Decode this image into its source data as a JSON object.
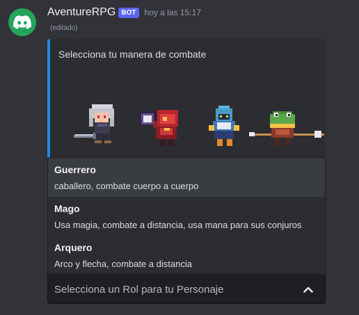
{
  "message": {
    "username": "AventureRPG",
    "badge": "BOT",
    "timestamp": "hoy a las 15:17",
    "edited": "(editado)"
  },
  "embed": {
    "description": "Selecciona tu manera de combate",
    "accent_color": "#1e88e5"
  },
  "select_menu": {
    "placeholder": "Selecciona un Rol para tu Personaje",
    "options": [
      {
        "label": "Guerrero",
        "description": "caballero, combate cuerpo a cuerpo"
      },
      {
        "label": "Mago",
        "description": "Usa magia, combate a distancia, usa mana para sus conjuros"
      },
      {
        "label": "Arquero",
        "description": "Arco y flecha, combate a distancia"
      }
    ],
    "hovered_option": "Guerrero"
  },
  "icons": {
    "avatar": "discord-logo-icon",
    "chevron": "chevron-up-icon"
  },
  "colors": {
    "background": "#313338",
    "bot_badge": "#5865f2",
    "avatar_bg": "#23a55a"
  }
}
